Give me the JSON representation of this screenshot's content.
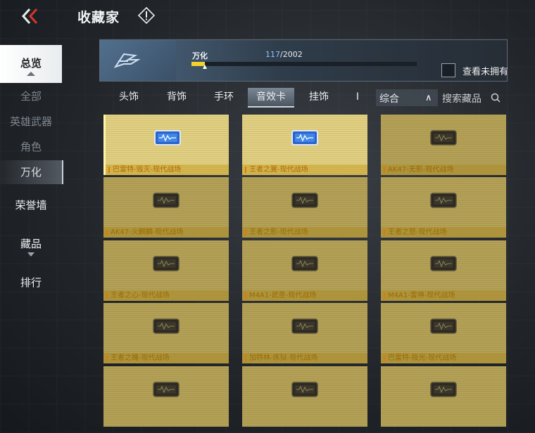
{
  "header": {
    "title": "收藏家"
  },
  "sidebar": {
    "overview": "总览",
    "sub_items": [
      "全部",
      "英雄武器",
      "角色",
      "万化"
    ],
    "honor_wall": "荣誉墙",
    "collectibles": "藏品",
    "ranking": "排行"
  },
  "banner": {
    "collection_name": "万化",
    "progress_current": "117",
    "progress_total": "/2002",
    "progress_fraction": 0.058
  },
  "filter": {
    "show_unowned": "查看未拥有"
  },
  "tabs": [
    "头饰",
    "背饰",
    "手环",
    "音效卡",
    "挂饰",
    "I"
  ],
  "active_tab": "音效卡",
  "sort": {
    "label": "综合"
  },
  "search": {
    "placeholder": "搜索藏品"
  },
  "items": [
    {
      "name": "巴雷特-毁灭-现代战场",
      "owned": true
    },
    {
      "name": "王者之翼-现代战场",
      "owned": true
    },
    {
      "name": "AK47-无影-现代战场",
      "owned": false
    },
    {
      "name": "AK47-火麒麟-现代战场",
      "owned": false
    },
    {
      "name": "王者之影-现代战场",
      "owned": false
    },
    {
      "name": "王者之怒-现代战场",
      "owned": false
    },
    {
      "name": "王者之心-现代战场",
      "owned": false
    },
    {
      "name": "M4A1-武圣-现代战场",
      "owned": false
    },
    {
      "name": "M4A1-雷神-现代战场",
      "owned": false
    },
    {
      "name": "王者之魄-现代战场",
      "owned": false
    },
    {
      "name": "加特林-炼狱-现代战场",
      "owned": false
    },
    {
      "name": "巴雷特-极光-现代战场",
      "owned": false
    },
    {
      "name": "",
      "owned": false
    },
    {
      "name": "",
      "owned": false
    },
    {
      "name": "",
      "owned": false
    }
  ]
}
